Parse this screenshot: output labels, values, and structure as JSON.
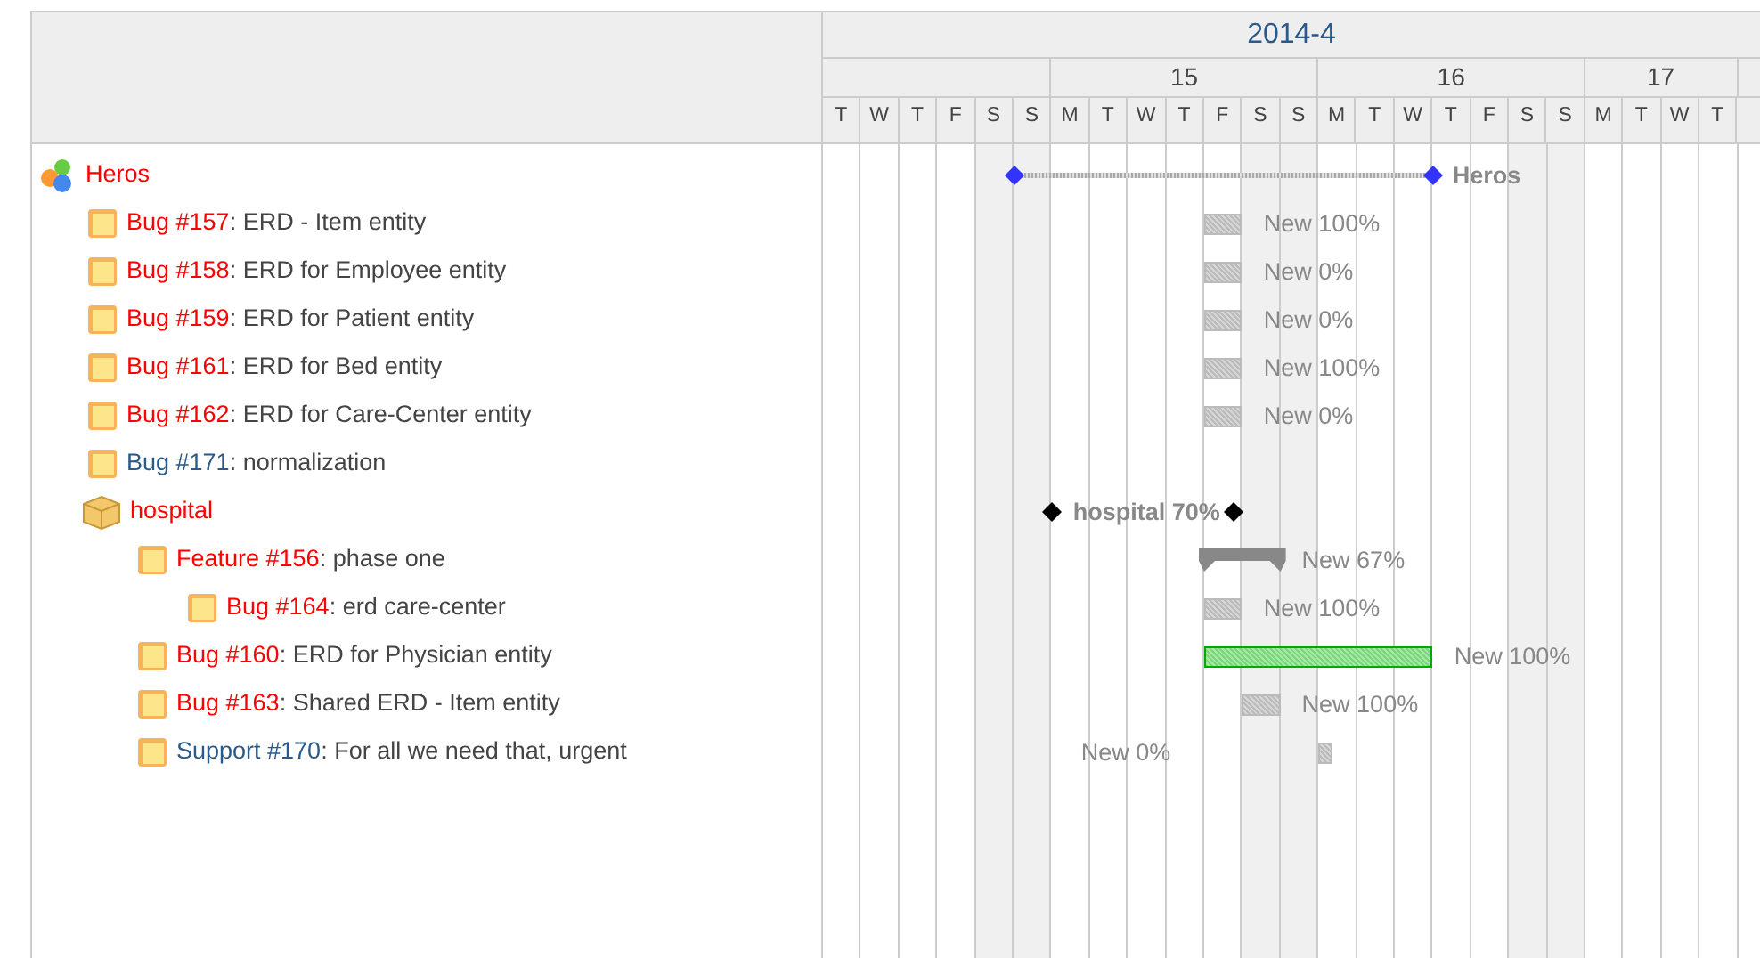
{
  "timeline": {
    "month": "2014-4",
    "weeks": [
      {
        "days": [
          {
            "letter": "T",
            "weekend": false
          },
          {
            "letter": "W",
            "weekend": false
          },
          {
            "letter": "T",
            "weekend": false
          },
          {
            "letter": "F",
            "weekend": false
          },
          {
            "letter": "S",
            "weekend": true
          },
          {
            "letter": "S",
            "weekend": true
          }
        ]
      },
      {
        "label": "15",
        "days": [
          {
            "letter": "M",
            "weekend": false
          },
          {
            "letter": "T",
            "weekend": false
          },
          {
            "letter": "W",
            "weekend": false
          },
          {
            "letter": "T",
            "weekend": false
          },
          {
            "letter": "F",
            "weekend": false
          },
          {
            "letter": "S",
            "weekend": true
          },
          {
            "letter": "S",
            "weekend": true
          }
        ]
      },
      {
        "label": "16",
        "days": [
          {
            "letter": "M",
            "weekend": false
          },
          {
            "letter": "T",
            "weekend": false
          },
          {
            "letter": "W",
            "weekend": false
          },
          {
            "letter": "T",
            "weekend": false
          },
          {
            "letter": "F",
            "weekend": false
          },
          {
            "letter": "S",
            "weekend": true
          },
          {
            "letter": "S",
            "weekend": true
          }
        ]
      },
      {
        "label": "17",
        "days": [
          {
            "letter": "M",
            "weekend": false
          },
          {
            "letter": "T",
            "weekend": false
          },
          {
            "letter": "W",
            "weekend": false
          },
          {
            "letter": "T",
            "weekend": false
          }
        ]
      }
    ]
  },
  "rows": [
    {
      "kind": "version",
      "name": "Heros",
      "color": "#ff0000",
      "bar": {
        "kind": "milestone",
        "label": "Heros"
      },
      "children": [
        {
          "kind": "issue",
          "link": "Bug #157",
          "rest": ": ERD - Item entity",
          "color": "#ff0000",
          "bar": {
            "kind": "task",
            "done": false,
            "label": "New 100%"
          }
        },
        {
          "kind": "issue",
          "link": "Bug #158",
          "rest": ": ERD for Employee entity",
          "color": "#ff0000",
          "bar": {
            "kind": "task",
            "done": false,
            "label": "New 0%"
          }
        },
        {
          "kind": "issue",
          "link": "Bug #159",
          "rest": ": ERD for Patient entity",
          "color": "#ff0000",
          "bar": {
            "kind": "task",
            "done": false,
            "label": "New 0%"
          }
        },
        {
          "kind": "issue",
          "link": "Bug #161",
          "rest": ": ERD for Bed entity",
          "color": "#ff0000",
          "bar": {
            "kind": "task",
            "done": false,
            "label": "New 100%"
          }
        },
        {
          "kind": "issue",
          "link": "Bug #162",
          "rest": ": ERD for Care-Center entity",
          "color": "#ff0000",
          "bar": {
            "kind": "task",
            "done": false,
            "label": "New 0%"
          }
        },
        {
          "kind": "issue",
          "link": "Bug #171",
          "rest": ": normalization",
          "color": "#2a5a8a"
        },
        {
          "kind": "project",
          "name": "hospital",
          "color": "#ff0000",
          "bar": {
            "kind": "project",
            "label": "hospital 70%"
          },
          "children": [
            {
              "kind": "issue",
              "link": "Feature #156",
              "rest": ": phase one",
              "color": "#ff0000",
              "bar": {
                "kind": "parent",
                "label": "New 67%"
              },
              "children": [
                {
                  "kind": "issue",
                  "link": "Bug #164",
                  "rest": ": erd care-center",
                  "color": "#ff0000",
                  "bar": {
                    "kind": "task",
                    "done": false,
                    "label": "New 100%"
                  }
                }
              ]
            },
            {
              "kind": "issue",
              "link": "Bug #160",
              "rest": ": ERD for Physician entity",
              "color": "#ff0000",
              "bar": {
                "kind": "task",
                "done": true,
                "label": "New 100%"
              }
            },
            {
              "kind": "issue",
              "link": "Bug #163",
              "rest": ": Shared ERD - Item entity",
              "color": "#ff0000",
              "bar": {
                "kind": "task",
                "done": false,
                "label": "New 100%"
              }
            },
            {
              "kind": "issue",
              "link": "Support #170",
              "rest": ": For all we need that, urgent",
              "color": "#2a5a8a",
              "bar": {
                "kind": "open",
                "done": false,
                "label": "New 0%"
              }
            }
          ]
        }
      ]
    }
  ]
}
